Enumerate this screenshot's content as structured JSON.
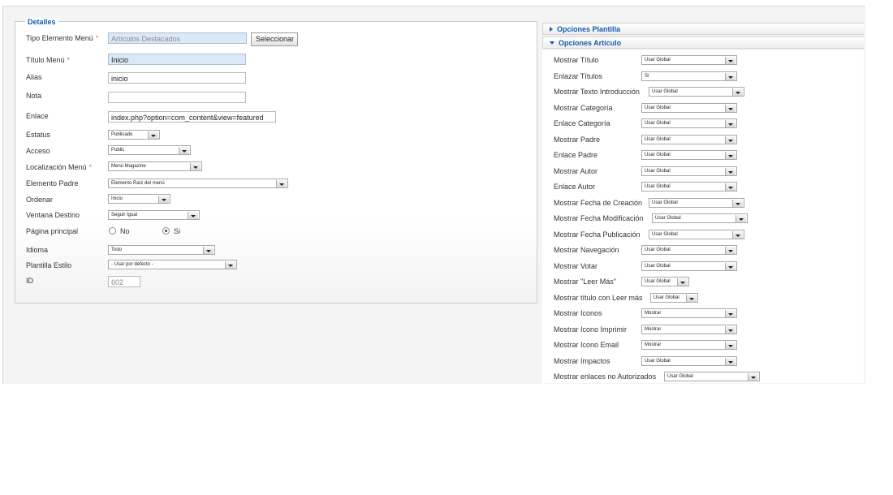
{
  "details": {
    "legend": "Detalles",
    "required_mark": "*",
    "fields": {
      "tipo": {
        "label": "Tipo Elemento Menú",
        "value": "Artículos Destacados",
        "button": "Seleccionar"
      },
      "titulo": {
        "label": "Título Menú",
        "value": "Inicio"
      },
      "alias": {
        "label": "Alias",
        "value": "inicio"
      },
      "nota": {
        "label": "Nota",
        "value": ""
      },
      "enlace": {
        "label": "Enlace",
        "value": "index.php?option=com_content&view=featured"
      },
      "estatus": {
        "label": "Estatus",
        "value": "Publicado"
      },
      "acceso": {
        "label": "Acceso",
        "value": "Public"
      },
      "localizacion": {
        "label": "Localización Menú",
        "value": "Menú Magazine"
      },
      "padre": {
        "label": "Elemento Padre",
        "value": "Elemento Raíz del menú"
      },
      "ordenar": {
        "label": "Ordenar",
        "value": "Inicio"
      },
      "ventana": {
        "label": "Ventana Destino",
        "value": "Seguir Igual"
      },
      "pagina": {
        "label": "Página principal",
        "option_no": "No",
        "option_si": "Si",
        "selected": "Si"
      },
      "idioma": {
        "label": "Idioma",
        "value": "Todo"
      },
      "plantilla": {
        "label": "Plantilla Estilo",
        "value": "- Usar por defecto -"
      },
      "id": {
        "label": "ID",
        "value": "602"
      }
    }
  },
  "panels": {
    "plantilla_title": "Opciones Plantilla",
    "articulo_title": "Opciones Artículo"
  },
  "article_options": [
    {
      "label": "Mostrar Título",
      "value": "Usar Global"
    },
    {
      "label": "Enlazar Títulos",
      "value": "Sí"
    },
    {
      "label": "Mostrar Texto Introducción",
      "value": "Usar Global"
    },
    {
      "label": "Mostrar Categoría",
      "value": "Usar Global"
    },
    {
      "label": "Enlace Categoría",
      "value": "Usar Global"
    },
    {
      "label": "Mostrar Padre",
      "value": "Usar Global"
    },
    {
      "label": "Enlace Padre",
      "value": "Usar Global"
    },
    {
      "label": "Mostrar Autor",
      "value": "Usar Global"
    },
    {
      "label": "Enlace Autor",
      "value": "Usar Global"
    },
    {
      "label": "Mostrar Fecha de Creación",
      "value": "Usar Global"
    },
    {
      "label": "Mostrar Fecha Modificación",
      "value": "Usar Global"
    },
    {
      "label": "Mostrar Fecha Publicación",
      "value": "Usar Global"
    },
    {
      "label": "Mostrar Navegación",
      "value": "Usar Global"
    },
    {
      "label": "Mostrar Votar",
      "value": "Usar Global"
    },
    {
      "label": "Mostrar \"Leer Más\"",
      "value": "Usar Global"
    },
    {
      "label": "Mostrar título con Leer más",
      "value": "Usar Global"
    },
    {
      "label": "Mostrar Iconos",
      "value": "Mostrar"
    },
    {
      "label": "Mostrar Icono Imprimir",
      "value": "Mostrar"
    },
    {
      "label": "Mostrar Icono Email",
      "value": "Mostrar"
    },
    {
      "label": "Mostrar Impactos",
      "value": "Usar Global"
    },
    {
      "label": "Mostrar enlaces no Autorizados",
      "value": "Usar Global"
    }
  ],
  "colors": {
    "accent": "#135cae",
    "required": "#e46b2a",
    "highlight_input": "#dbe9f6"
  }
}
